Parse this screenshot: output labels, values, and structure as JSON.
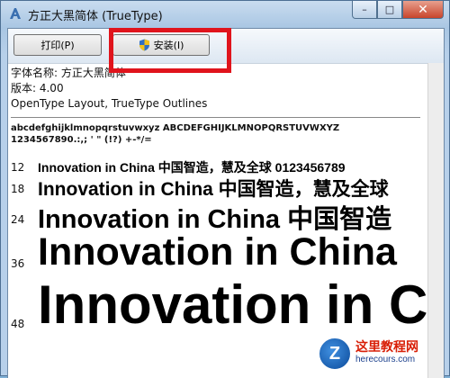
{
  "window": {
    "title": "方正大黑简体 (TrueType)",
    "controls": {
      "minimize": "–",
      "maximize": "□",
      "close": "✕"
    }
  },
  "toolbar": {
    "print_label": "打印(P)",
    "install_label": "安装(I)"
  },
  "font_info": {
    "name_line": "字体名称: 方正大黑简体",
    "version_line": "版本: 4.00",
    "type_line": "OpenType Layout, TrueType Outlines"
  },
  "charset": {
    "line1": "abcdefghijklmnopqrstuvwxyz ABCDEFGHIJKLMNOPQRSTUVWXYZ",
    "line2": "1234567890.:,; ' \" (!?) +-*/="
  },
  "samples": [
    {
      "size": "12",
      "text": "Innovation in China 中国智造，慧及全球 0123456789"
    },
    {
      "size": "18",
      "text": "Innovation in China 中国智造，慧及全球"
    },
    {
      "size": "24",
      "text": "Innovation in China 中国智造"
    },
    {
      "size": "36",
      "text": "Innovation in China"
    },
    {
      "size": "48",
      "text": "Innovation in C"
    }
  ],
  "watermark": {
    "logo_letter": "Z",
    "name": "这里教程网",
    "url": "herecours.com"
  },
  "colors": {
    "highlight": "#e0141c",
    "close_button": "#c8452c"
  }
}
